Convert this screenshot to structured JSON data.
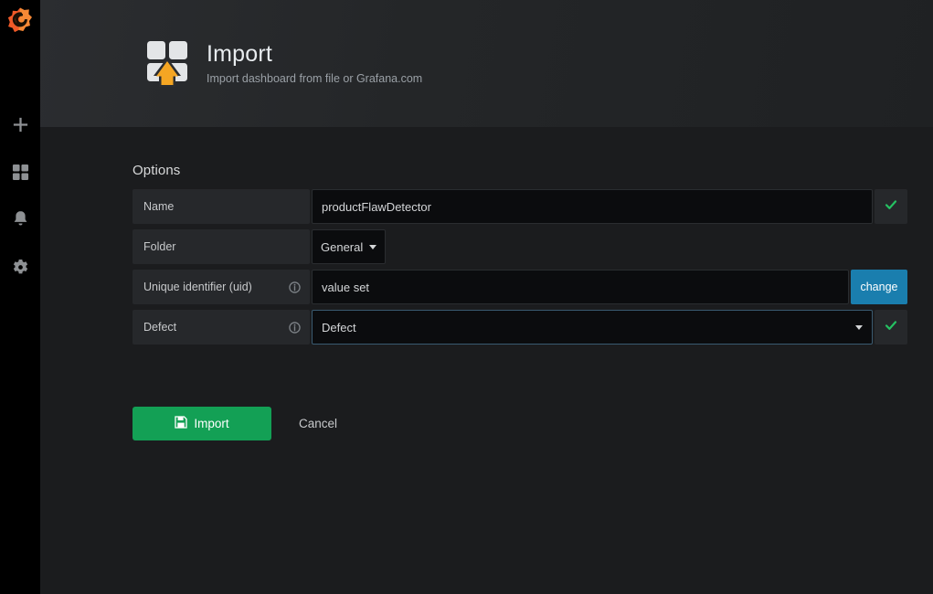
{
  "sidebar": {
    "logo": "grafana-logo",
    "items": [
      {
        "icon": "plus-icon",
        "name": "create"
      },
      {
        "icon": "dashboards-icon",
        "name": "dashboards"
      },
      {
        "icon": "bell-icon",
        "name": "alerting"
      },
      {
        "icon": "gear-icon",
        "name": "configuration"
      }
    ]
  },
  "header": {
    "icon": "import-dashboard-icon",
    "title": "Import",
    "subtitle": "Import dashboard from file or Grafana.com"
  },
  "options": {
    "section_title": "Options",
    "rows": [
      {
        "label": "Name",
        "value": "productFlawDetector",
        "type": "text",
        "has_info": false,
        "valid": true,
        "focused": false
      },
      {
        "label": "Folder",
        "value": "General",
        "type": "select-small",
        "has_info": false,
        "valid": false,
        "focused": false
      },
      {
        "label": "Unique identifier (uid)",
        "value": "value set",
        "type": "text-with-change",
        "has_info": true,
        "valid": false,
        "focused": false,
        "change_label": "change"
      },
      {
        "label": "Defect",
        "value": "Defect",
        "type": "select",
        "has_info": true,
        "valid": true,
        "focused": true
      }
    ]
  },
  "actions": {
    "import_label": "Import",
    "import_icon": "save-icon",
    "cancel_label": "Cancel"
  },
  "colors": {
    "sidebar_bg": "#000000",
    "page_bg": "#1b1c1e",
    "label_bg": "#26282b",
    "input_bg": "#0b0c0e",
    "accent_green": "#13a055",
    "valid_check": "#25c162",
    "change_blue": "#1a7eae",
    "logo_orange": "#f05a28",
    "arrow_amber": "#f5a623",
    "title_text": "#e8ecef",
    "subtitle_text": "#9aa0a6",
    "focus_border": "#3a5a70"
  }
}
